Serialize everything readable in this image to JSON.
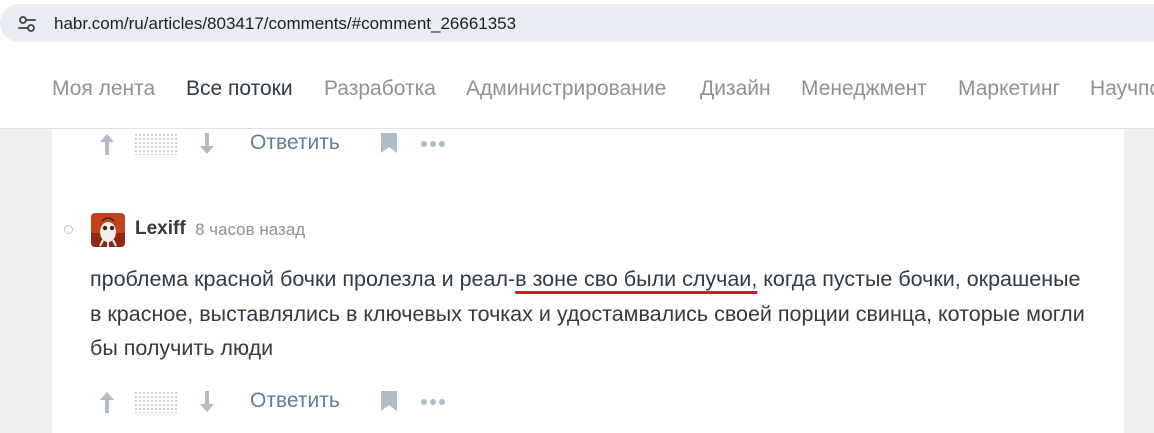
{
  "browser": {
    "url": "habr.com/ru/articles/803417/comments/#comment_26661353"
  },
  "nav": {
    "items": [
      "Моя лента",
      "Все потоки",
      "Разработка",
      "Администрирование",
      "Дизайн",
      "Менеджмент",
      "Маркетинг",
      "Научпоп"
    ],
    "active": "Все потоки"
  },
  "prev_comment_actions": {
    "reply_label": "Ответить"
  },
  "comment": {
    "author": "Lexiff",
    "time": "8 часов назад",
    "text_before": "проблема красной бочки пролезла и реал-",
    "text_highlight": "в зоне сво были случаи,",
    "text_after": " когда пустые бочки, окрашеные в красное, выставлялись в ключевых точках и удостамвались своей порции свинца, которые могли бы получить люди",
    "highlight_color": "#d11a22",
    "reply_label": "Ответить"
  },
  "colors": {
    "accent_link": "#5e7f98",
    "text": "#303b44",
    "muted": "#8d9297",
    "icon": "#aebdc9"
  }
}
